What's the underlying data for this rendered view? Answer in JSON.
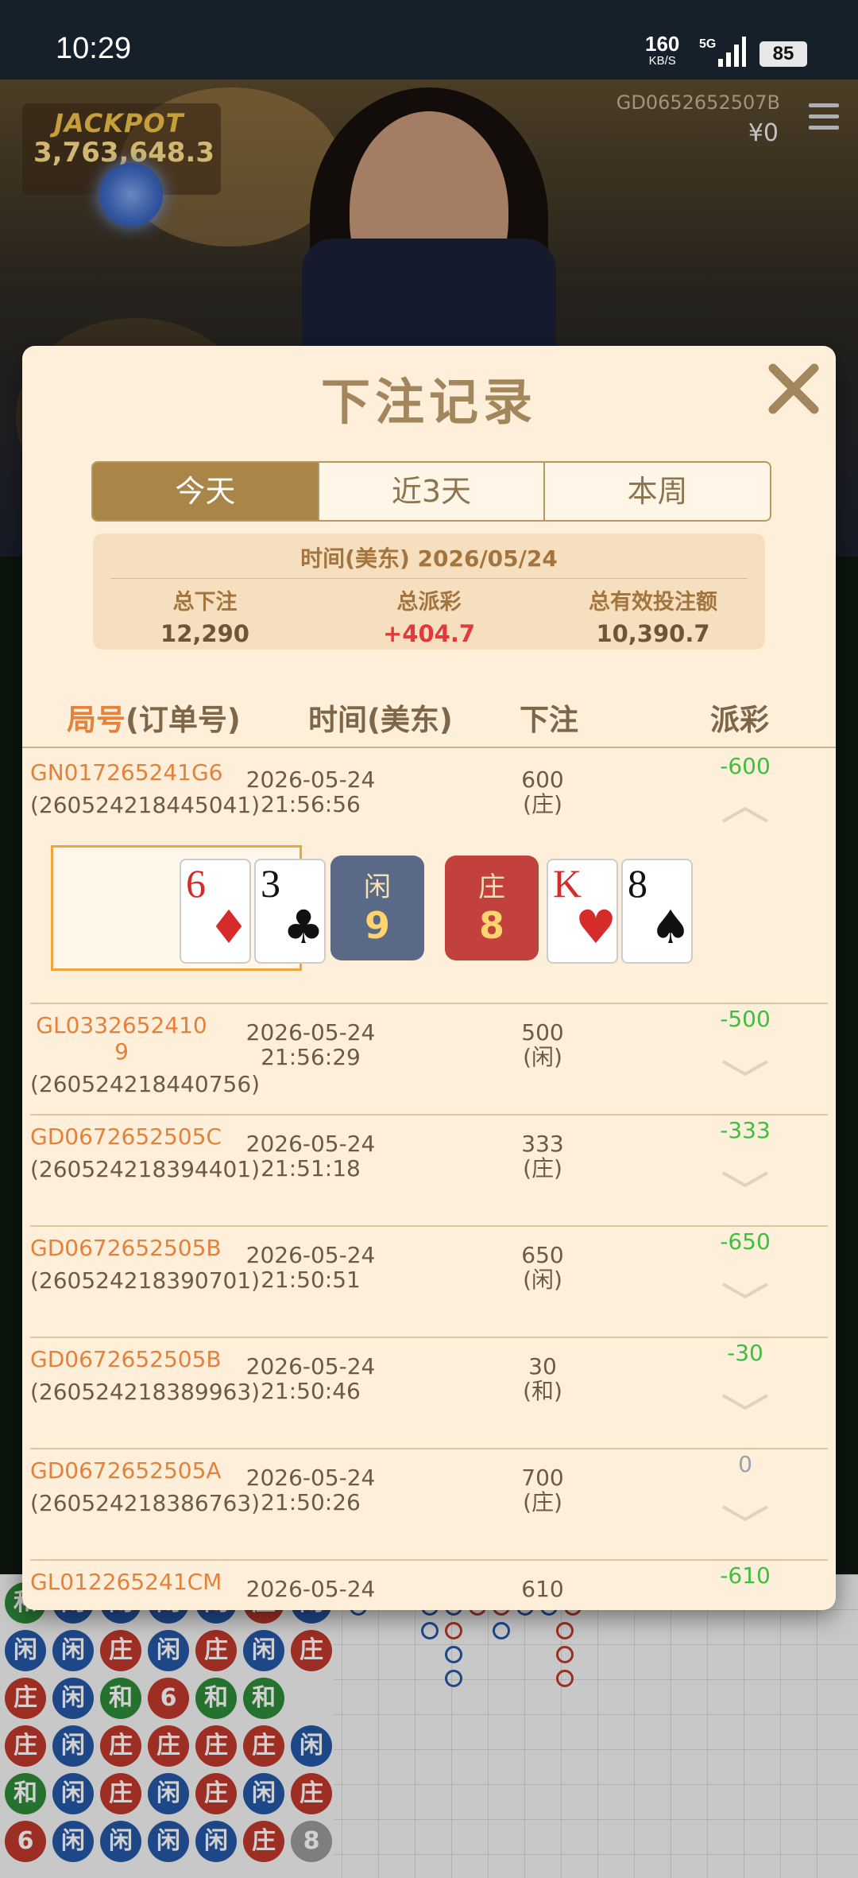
{
  "status_bar": {
    "time": "10:29",
    "speed_value": "160",
    "speed_unit": "KB/S",
    "network": "5G",
    "battery": "85"
  },
  "game": {
    "jackpot_title": "JACKPOT",
    "jackpot_value": "3,763,648.3",
    "round_id": "GD0652652507B",
    "balance": "¥0"
  },
  "modal": {
    "title": "下注记录",
    "tabs": [
      {
        "label": "今天",
        "active": true
      },
      {
        "label": "近3天",
        "active": false
      },
      {
        "label": "本周",
        "active": false
      }
    ],
    "summary": {
      "date_label": "时间(美东) 2026/05/24",
      "total_bet_label": "总下注",
      "total_bet": "12,290",
      "total_payout_label": "总派彩",
      "total_payout": "+404.7",
      "valid_bet_label": "总有效投注额",
      "valid_bet": "10,390.7"
    },
    "columns": {
      "id_prefix": "局号",
      "id_suffix": "(订单号)",
      "time": "时间(美东)",
      "bet": "下注",
      "payout": "派彩"
    },
    "rows": [
      {
        "game_id": "GN017265241G6",
        "order_id": "(260524218445041)",
        "date": "2026-05-24",
        "time": "21:56:56",
        "bet": "600",
        "side": "(庄)",
        "payout": "-600",
        "expanded": true
      },
      {
        "game_id": "GL0332652410 9",
        "order_id": "(260524218440756)",
        "date": "2026-05-24",
        "time": "21:56:29",
        "bet": "500",
        "side": "(闲)",
        "payout": "-500",
        "expanded": false
      },
      {
        "game_id": "GD0672652505C",
        "order_id": "(260524218394401)",
        "date": "2026-05-24",
        "time": "21:51:18",
        "bet": "333",
        "side": "(庄)",
        "payout": "-333",
        "expanded": false
      },
      {
        "game_id": "GD0672652505B",
        "order_id": "(260524218390701)",
        "date": "2026-05-24",
        "time": "21:50:51",
        "bet": "650",
        "side": "(闲)",
        "payout": "-650",
        "expanded": false
      },
      {
        "game_id": "GD0672652505B",
        "order_id": "(260524218389963)",
        "date": "2026-05-24",
        "time": "21:50:46",
        "bet": "30",
        "side": "(和)",
        "payout": "-30",
        "expanded": false
      },
      {
        "game_id": "GD0672652505A",
        "order_id": "(260524218386763)",
        "date": "2026-05-24",
        "time": "21:50:26",
        "bet": "700",
        "side": "(庄)",
        "payout": "0",
        "expanded": false
      },
      {
        "game_id": "GL012265241CM",
        "order_id": "",
        "date": "2026-05-24",
        "time": "",
        "bet": "610",
        "side": "",
        "payout": "-610",
        "expanded": false
      }
    ],
    "hand": {
      "player_cards": [
        {
          "rank": "6",
          "suit": "♦",
          "color": "#d62b2b"
        },
        {
          "rank": "3",
          "suit": "♣",
          "color": "#111111"
        }
      ],
      "player_label": "闲",
      "player_score": "9",
      "banker_label": "庄",
      "banker_score": "8",
      "banker_cards": [
        {
          "rank": "K",
          "suit": "♥",
          "color": "#d62b2b"
        },
        {
          "rank": "8",
          "suit": "♠",
          "color": "#111111"
        }
      ]
    }
  },
  "colors": {
    "banker": "#c0392b",
    "player": "#2557a7",
    "tie": "#2e8b3a",
    "accent": "#a98547"
  }
}
